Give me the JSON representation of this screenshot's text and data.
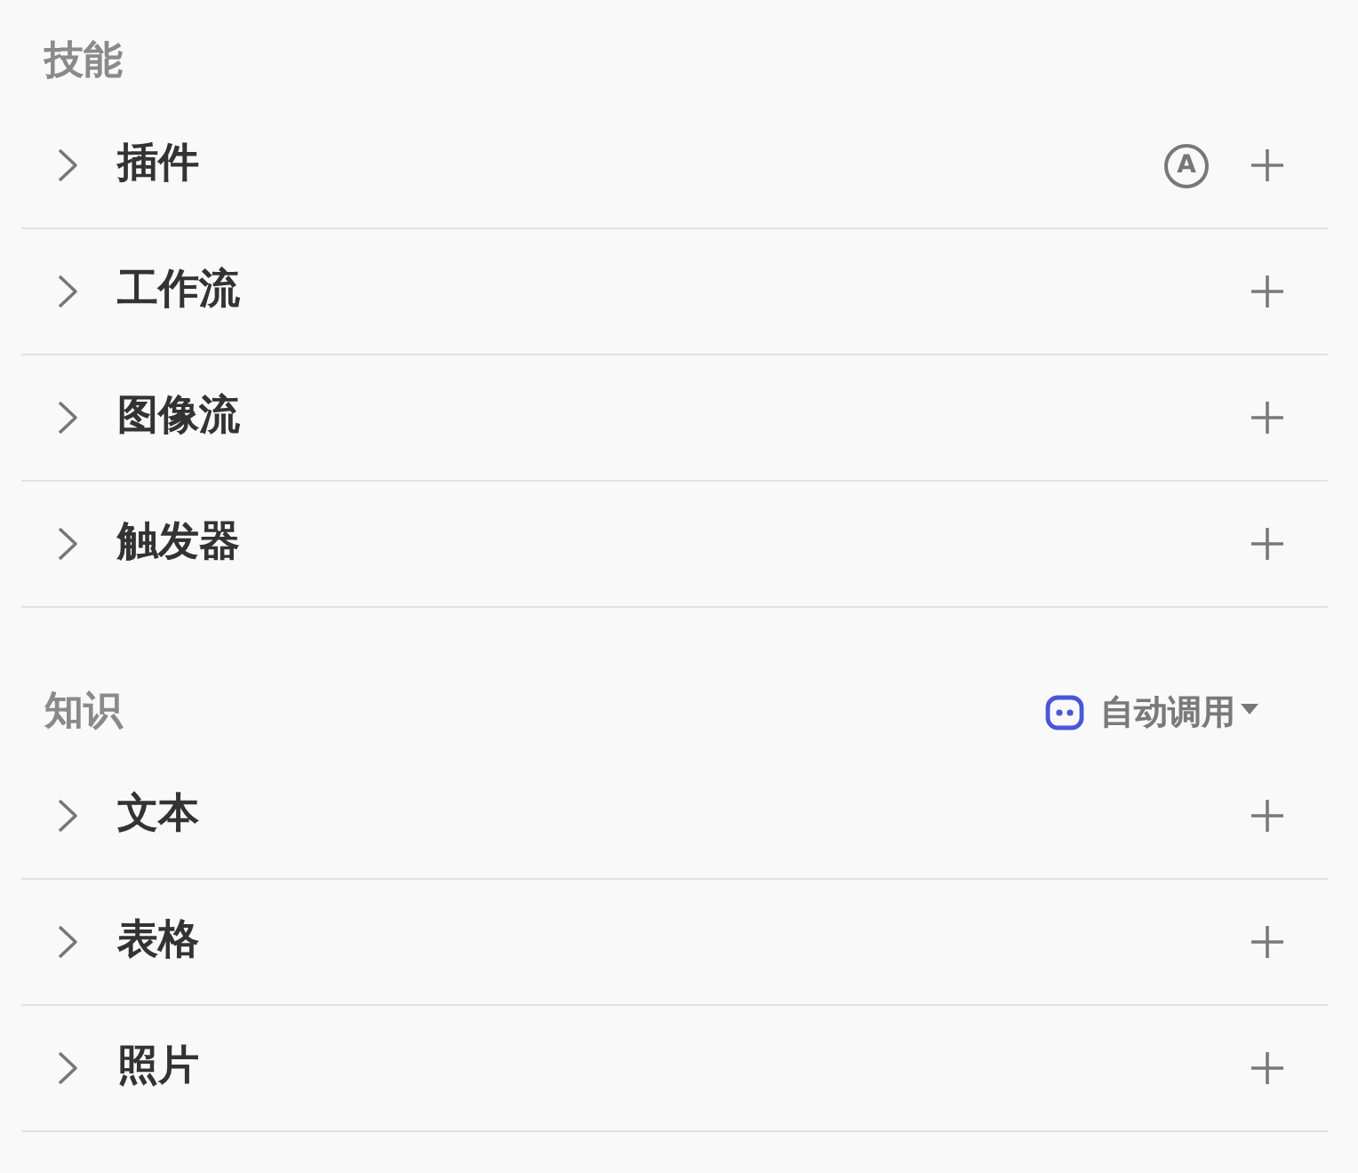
{
  "sections": [
    {
      "title": "技能",
      "rows": [
        {
          "label": "插件",
          "expanded": false,
          "badge": "A"
        },
        {
          "label": "工作流",
          "expanded": false
        },
        {
          "label": "图像流",
          "expanded": false
        },
        {
          "label": "触发器",
          "expanded": false
        }
      ]
    },
    {
      "title": "知识",
      "dropdown": {
        "label": "自动调用"
      },
      "rows": [
        {
          "label": "文本",
          "expanded": false
        },
        {
          "label": "表格",
          "expanded": false
        },
        {
          "label": "照片",
          "expanded": false
        }
      ]
    }
  ]
}
